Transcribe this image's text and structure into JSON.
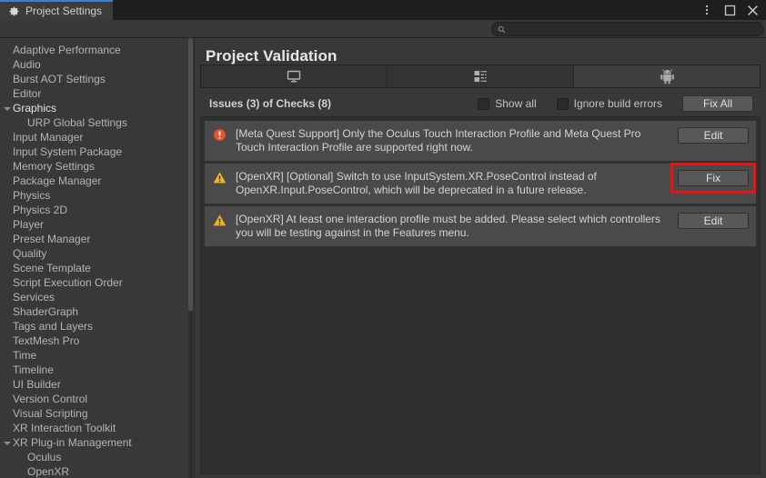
{
  "window": {
    "tab_label": "Project Settings",
    "tab_icon": "gear-icon",
    "controls": [
      {
        "name": "more-options-icon",
        "glyph": "kebab"
      },
      {
        "name": "maximize-icon",
        "glyph": "square"
      },
      {
        "name": "close-icon",
        "glyph": "x"
      }
    ]
  },
  "search": {
    "value": "",
    "placeholder": "",
    "icon": "search-icon"
  },
  "sidebar": {
    "items": [
      {
        "label": "Adaptive Performance",
        "indent": 0,
        "expander": "none",
        "bright": false
      },
      {
        "label": "Audio",
        "indent": 0,
        "expander": "none",
        "bright": false
      },
      {
        "label": "Burst AOT Settings",
        "indent": 0,
        "expander": "none",
        "bright": false
      },
      {
        "label": "Editor",
        "indent": 0,
        "expander": "none",
        "bright": false
      },
      {
        "label": "Graphics",
        "indent": 0,
        "expander": "open",
        "bright": true
      },
      {
        "label": "URP Global Settings",
        "indent": 1,
        "expander": "none",
        "bright": false
      },
      {
        "label": "Input Manager",
        "indent": 0,
        "expander": "none",
        "bright": false
      },
      {
        "label": "Input System Package",
        "indent": 0,
        "expander": "none",
        "bright": false
      },
      {
        "label": "Memory Settings",
        "indent": 0,
        "expander": "none",
        "bright": false
      },
      {
        "label": "Package Manager",
        "indent": 0,
        "expander": "none",
        "bright": false
      },
      {
        "label": "Physics",
        "indent": 0,
        "expander": "none",
        "bright": false
      },
      {
        "label": "Physics 2D",
        "indent": 0,
        "expander": "none",
        "bright": false
      },
      {
        "label": "Player",
        "indent": 0,
        "expander": "none",
        "bright": false
      },
      {
        "label": "Preset Manager",
        "indent": 0,
        "expander": "none",
        "bright": false
      },
      {
        "label": "Quality",
        "indent": 0,
        "expander": "none",
        "bright": false
      },
      {
        "label": "Scene Template",
        "indent": 0,
        "expander": "none",
        "bright": false
      },
      {
        "label": "Script Execution Order",
        "indent": 0,
        "expander": "none",
        "bright": false
      },
      {
        "label": "Services",
        "indent": 0,
        "expander": "none",
        "bright": false
      },
      {
        "label": "ShaderGraph",
        "indent": 0,
        "expander": "none",
        "bright": false
      },
      {
        "label": "Tags and Layers",
        "indent": 0,
        "expander": "none",
        "bright": false
      },
      {
        "label": "TextMesh Pro",
        "indent": 0,
        "expander": "none",
        "bright": false
      },
      {
        "label": "Time",
        "indent": 0,
        "expander": "none",
        "bright": false
      },
      {
        "label": "Timeline",
        "indent": 0,
        "expander": "none",
        "bright": false
      },
      {
        "label": "UI Builder",
        "indent": 0,
        "expander": "none",
        "bright": false
      },
      {
        "label": "Version Control",
        "indent": 0,
        "expander": "none",
        "bright": false
      },
      {
        "label": "Visual Scripting",
        "indent": 0,
        "expander": "none",
        "bright": false
      },
      {
        "label": "XR Interaction Toolkit",
        "indent": 0,
        "expander": "none",
        "bright": false
      },
      {
        "label": "XR Plug-in Management",
        "indent": 0,
        "expander": "open",
        "bright": false
      },
      {
        "label": "Oculus",
        "indent": 1,
        "expander": "none",
        "bright": false
      },
      {
        "label": "OpenXR",
        "indent": 1,
        "expander": "none",
        "bright": false
      }
    ]
  },
  "main": {
    "title": "Project Validation",
    "platform_tabs": [
      {
        "name": "tab-standalone",
        "icon": "monitor-icon",
        "selected": false
      },
      {
        "name": "tab-dedicated-server",
        "icon": "server-icon",
        "selected": false
      },
      {
        "name": "tab-android",
        "icon": "android-icon",
        "selected": true
      }
    ],
    "toolbar": {
      "issues_label": "Issues (3) of Checks (8)",
      "show_all_label": "Show all",
      "show_all_checked": false,
      "ignore_build_errors_label": "Ignore build errors",
      "ignore_build_errors_checked": false,
      "fix_all_label": "Fix All"
    },
    "issues": [
      {
        "severity": "error",
        "icon": "error-icon",
        "text": "[Meta Quest Support] Only the Oculus Touch Interaction Profile and Meta Quest Pro Touch Interaction Profile are supported right now.",
        "button_label": "Edit",
        "highlighted": false
      },
      {
        "severity": "warning",
        "icon": "warning-icon",
        "text": "[OpenXR] [Optional] Switch to use InputSystem.XR.PoseControl instead of OpenXR.Input.PoseControl, which will be deprecated in a future release.",
        "button_label": "Fix",
        "highlighted": true
      },
      {
        "severity": "warning",
        "icon": "warning-icon",
        "text": "[OpenXR] At least one interaction profile must be added.  Please select which controllers you will be testing against in the Features menu.",
        "button_label": "Edit",
        "highlighted": false
      }
    ]
  },
  "colors": {
    "accent_tab": "#3d7fd0",
    "error": "#e8552d",
    "warning": "#f0b323",
    "highlight_box": "#e81313",
    "panel_bg": "#383838",
    "row_bg": "#4a4a4a"
  }
}
